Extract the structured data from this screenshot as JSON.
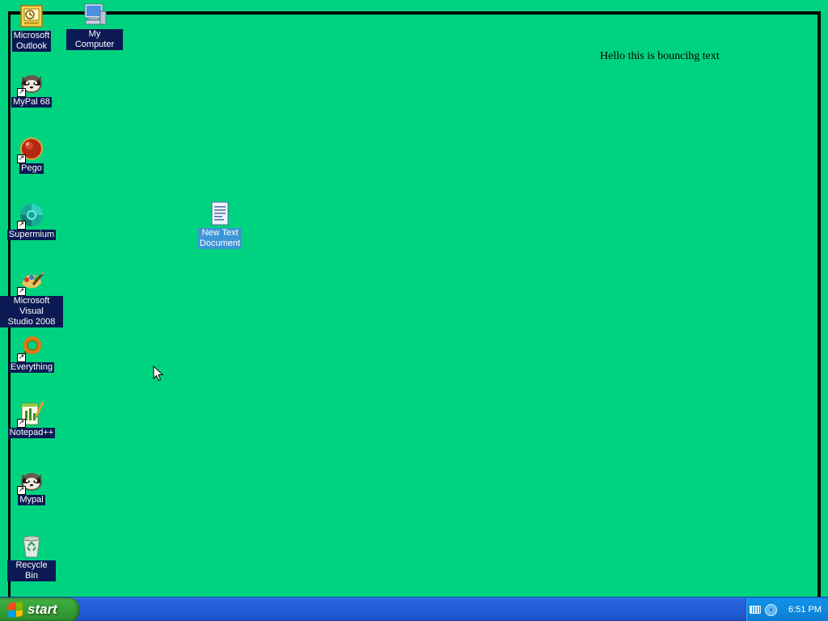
{
  "desktop": {
    "background_color": "#00d37f",
    "bouncing_text": "Hello this is bouncihg text",
    "icons": [
      {
        "label": "Microsoft\nOutlook",
        "icon": "outlook-icon",
        "shortcut": false
      },
      {
        "label": "My Computer",
        "icon": "my-computer-icon",
        "shortcut": false
      },
      {
        "label": "MyPal 68",
        "icon": "mypal-icon",
        "shortcut": true
      },
      {
        "label": "Pego",
        "icon": "pego-icon",
        "shortcut": true
      },
      {
        "label": "Supermium",
        "icon": "supermium-icon",
        "shortcut": true
      },
      {
        "label": "New Text\nDocument",
        "icon": "text-document-icon",
        "shortcut": false,
        "selected": true
      },
      {
        "label": "Microsoft Visual\nStudio 2008",
        "icon": "visual-studio-icon",
        "shortcut": true
      },
      {
        "label": "Everything",
        "icon": "everything-search-icon",
        "shortcut": true
      },
      {
        "label": "Notepad++",
        "icon": "notepad-plus-plus-icon",
        "shortcut": true
      },
      {
        "label": "Mypal",
        "icon": "mypal-icon",
        "shortcut": true
      },
      {
        "label": "Recycle Bin",
        "icon": "recycle-bin-icon",
        "shortcut": false
      }
    ]
  },
  "taskbar": {
    "start_label": "start",
    "clock": "6:51 PM",
    "tray_icons": [
      "keyboard-icon",
      "show-hidden-icons-chevron"
    ]
  },
  "colors": {
    "taskbar_blue": "#245edb",
    "start_green": "#35a035",
    "tray_blue": "#0f8ae0",
    "label_highlight": "#0c1a54",
    "selected_highlight": "#3d95d8"
  }
}
